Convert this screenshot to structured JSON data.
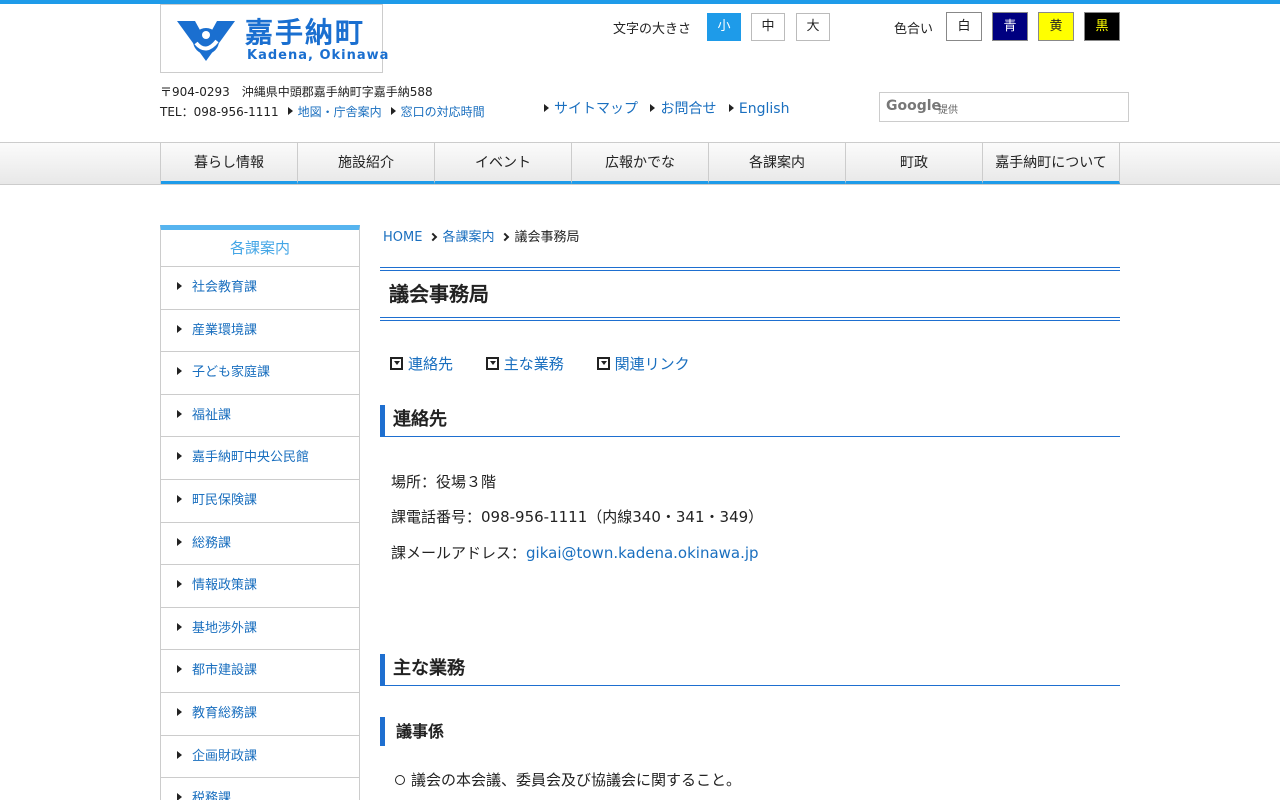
{
  "header": {
    "logo_jp": "嘉手納町",
    "logo_en": "Kadena, Okinawa",
    "font_size_label": "文字の大きさ",
    "font_sizes": [
      "小",
      "中",
      "大"
    ],
    "color_label": "色合い",
    "colors": [
      {
        "label": "白",
        "bg": "#ffffff",
        "fg": "#222222"
      },
      {
        "label": "青",
        "bg": "#000080",
        "fg": "#ffffff"
      },
      {
        "label": "黄",
        "bg": "#ffff00",
        "fg": "#222222"
      },
      {
        "label": "黒",
        "bg": "#000000",
        "fg": "#ffff00"
      }
    ],
    "address": "〒904-0293　沖縄県中頭郡嘉手納町字嘉手納588",
    "tel": "TEL：098-956-1111",
    "links": [
      "地図・庁舎案内",
      "窓口の対応時間"
    ],
    "utility_links": [
      "サイトマップ",
      "お問合せ",
      "English"
    ],
    "search_brand": "Google",
    "search_provided": "提供"
  },
  "nav": [
    "暮らし情報",
    "施設紹介",
    "イベント",
    "広報かでな",
    "各課案内",
    "町政",
    "嘉手納町について"
  ],
  "sidebar": {
    "title": "各課案内",
    "items": [
      "社会教育課",
      "産業環境課",
      "子ども家庭課",
      "福祉課",
      "嘉手納町中央公民館",
      "町民保険課",
      "総務課",
      "情報政策課",
      "基地渉外課",
      "都市建設課",
      "教育総務課",
      "企画財政課",
      "税務課"
    ]
  },
  "breadcrumb": [
    "HOME",
    "各課案内",
    "議会事務局"
  ],
  "page_title": "議会事務局",
  "anchors": [
    "連絡先",
    "主な業務",
    "関連リンク"
  ],
  "contact": {
    "heading": "連絡先",
    "location": "場所：役場３階",
    "phone": "課電話番号：098-956-1111（内線340・341・349）",
    "email_label": "課メールアドレス：",
    "email": "gikai@town.kadena.okinawa.jp"
  },
  "duties": {
    "heading": "主な業務",
    "subheading": "議事係",
    "items": [
      "議会の本会議、委員会及び協議会に関すること。"
    ]
  }
}
